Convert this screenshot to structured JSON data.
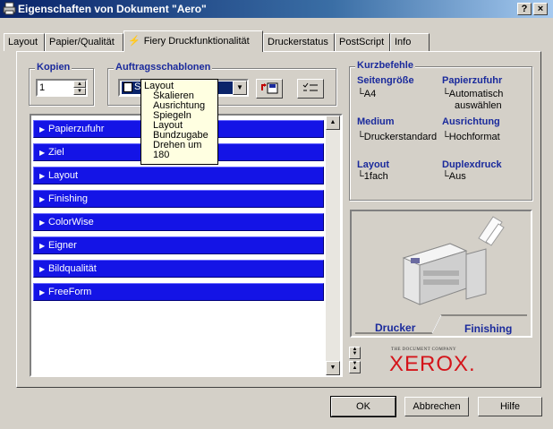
{
  "window": {
    "title": "Eigenschaften von Dokument \"Aero\"",
    "help_label": "?",
    "close_label": "×"
  },
  "tabs": [
    {
      "label": "Layout"
    },
    {
      "label": "Papier/Qualität"
    },
    {
      "label": "Fiery Druckfunktionalität"
    },
    {
      "label": "Druckerstatus"
    },
    {
      "label": "PostScript"
    },
    {
      "label": "Info"
    }
  ],
  "copies": {
    "title": "Kopien",
    "value": "1"
  },
  "job_templates": {
    "title": "Auftragsschablonen",
    "selected_prefix": "S"
  },
  "template_popup": {
    "heading": "Layout",
    "items": [
      "Skalieren",
      "Ausrichtung",
      "Spiegeln",
      "Layout",
      "Bundzugabe",
      "Drehen um 180"
    ]
  },
  "sections": [
    "Papierzufuhr",
    "Ziel",
    "Layout",
    "Finishing",
    "ColorWise",
    "Eigner",
    "Bildqualität",
    "FreeForm"
  ],
  "shortcuts": {
    "title": "Kurzbefehle",
    "page_size_label": "Seitengröße",
    "page_size_value": "A4",
    "paper_feed_label": "Papierzufuhr",
    "paper_feed_value_1": "Automatisch",
    "paper_feed_value_2": "auswählen",
    "media_label": "Medium",
    "media_value": "Druckerstandard",
    "orientation_label": "Ausrichtung",
    "orientation_value": "Hochformat",
    "layout_label": "Layout",
    "layout_value": "1fach",
    "duplex_label": "Duplexdruck",
    "duplex_value": "Aus"
  },
  "preview_tabs": {
    "printer": "Drucker",
    "finishing": "Finishing"
  },
  "xerox": {
    "tagline": "THE DOCUMENT COMPANY",
    "logo": "XEROX."
  },
  "buttons": {
    "ok": "OK",
    "cancel": "Abbrechen",
    "help": "Hilfe"
  },
  "colors": {
    "section_bar": "#1414e6",
    "label_blue": "#1a2a9c",
    "xerox_red": "#d4141a"
  }
}
